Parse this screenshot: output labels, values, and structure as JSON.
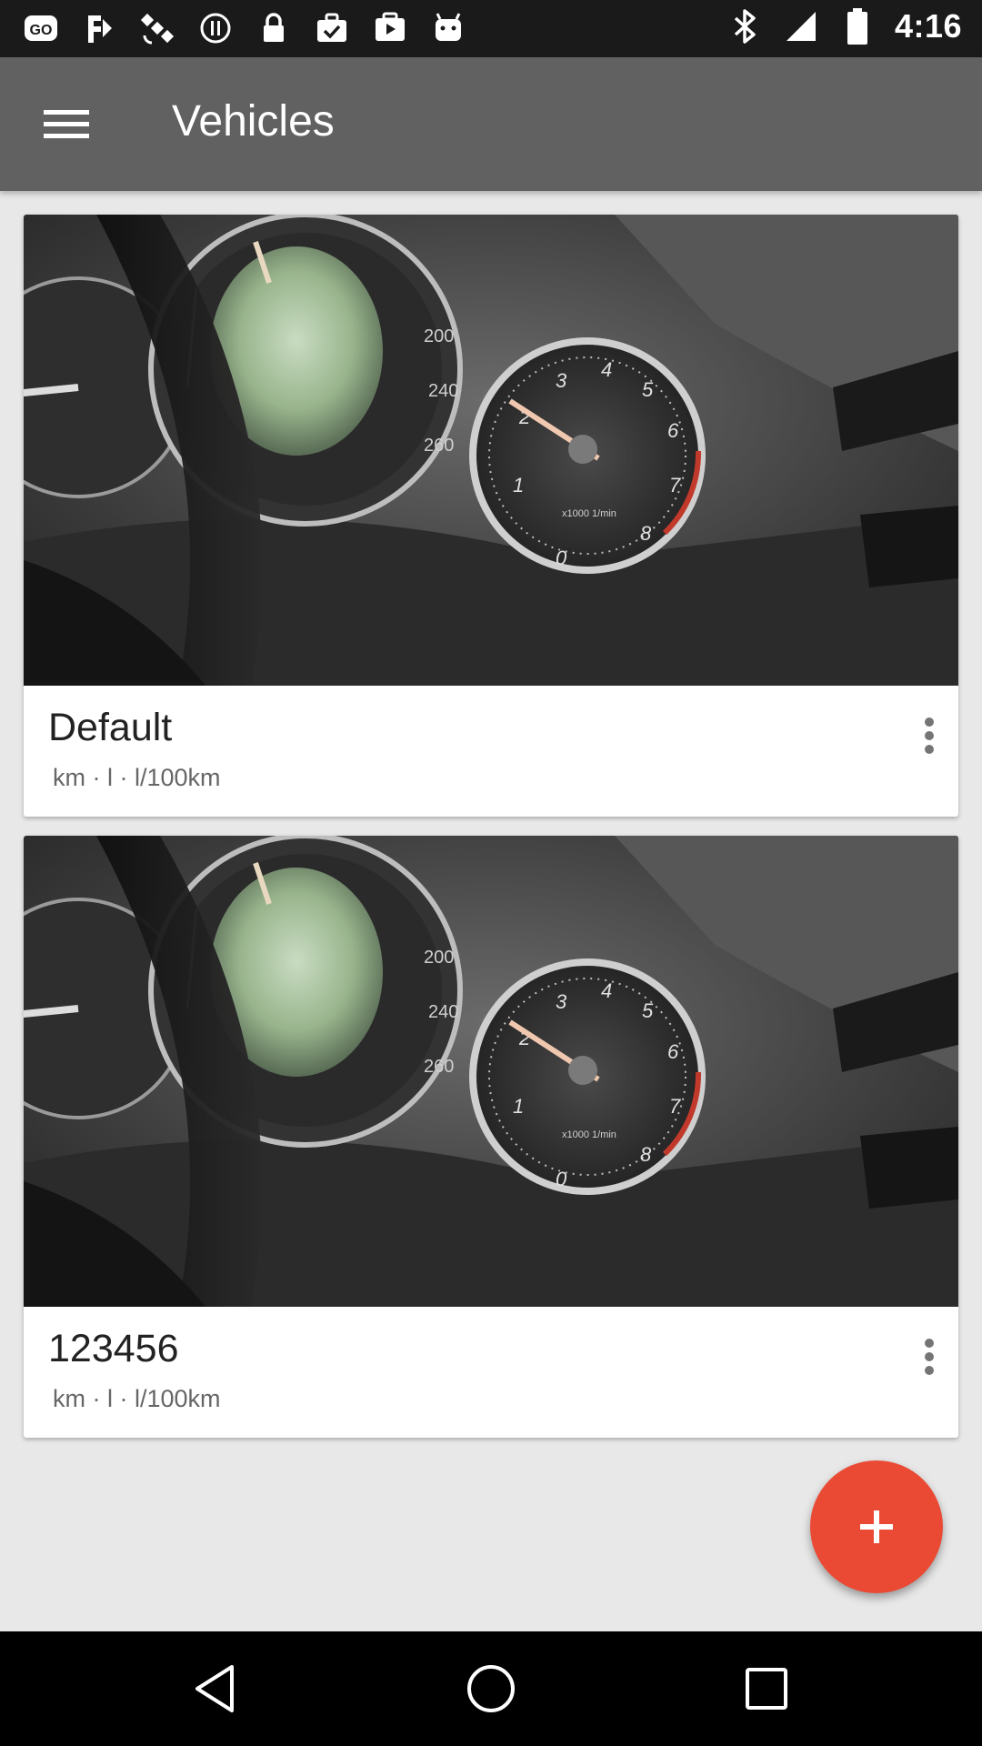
{
  "status_bar": {
    "time": "4:16",
    "left_icons": [
      "go-app-icon",
      "fake-gps-icon",
      "satellite-icon",
      "sync-paused-icon",
      "lock-icon",
      "briefcase-check-icon",
      "play-store-icon",
      "android-icon"
    ],
    "right_icons": [
      "bluetooth-icon",
      "signal-icon",
      "battery-icon"
    ]
  },
  "app_bar": {
    "title": "Vehicles",
    "menu_icon": "hamburger-menu-icon"
  },
  "vehicles": [
    {
      "name": "Default",
      "units": "km · l · l/100km"
    },
    {
      "name": "123456",
      "units": "km · l · l/100km"
    }
  ],
  "fab": {
    "icon": "plus-icon"
  },
  "nav_bar": {
    "buttons": [
      "back-icon",
      "home-icon",
      "recents-icon"
    ]
  },
  "colors": {
    "app_bar": "#616161",
    "status_bar": "#1a1a1a",
    "background": "#e8e8e8",
    "fab": "#ea4a34"
  }
}
